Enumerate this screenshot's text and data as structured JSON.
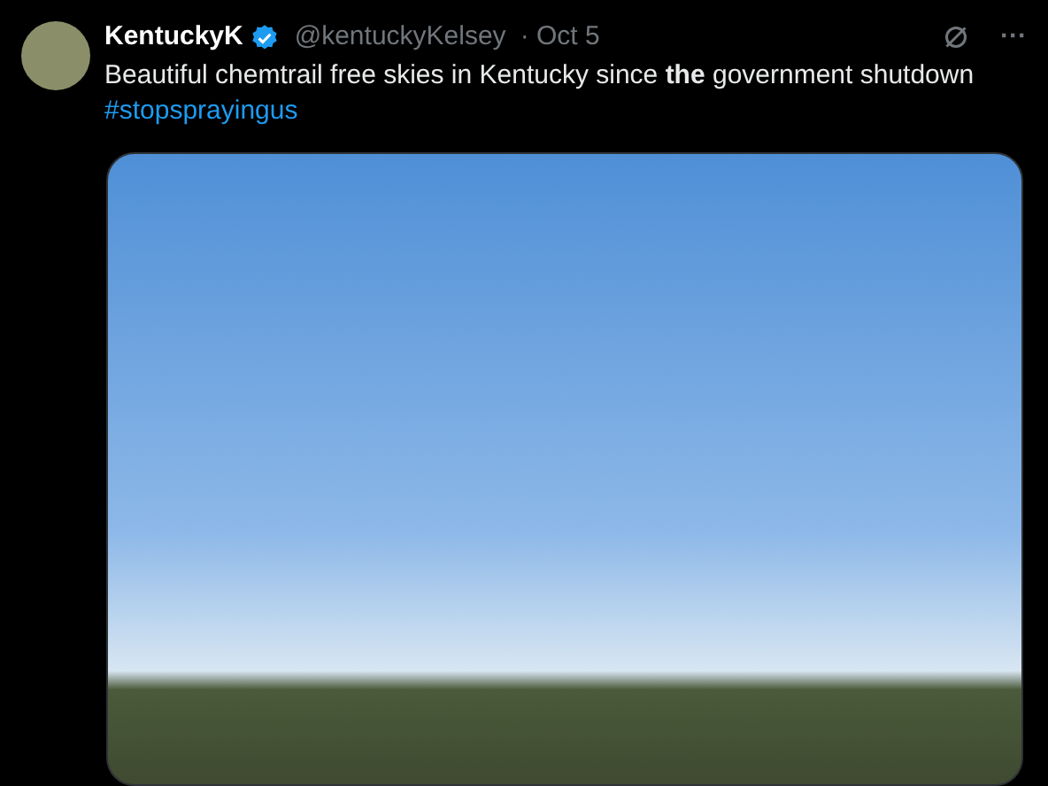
{
  "post": {
    "author": {
      "name": "KentuckyK",
      "verified": true,
      "handle": "@kentuckyKelsey",
      "date": "· Oct 5"
    },
    "text": "Beautiful chemtrail free skies in Kentucky since **the** government shutdown",
    "hashtag": "#stopsprayingus",
    "more": "···"
  }
}
